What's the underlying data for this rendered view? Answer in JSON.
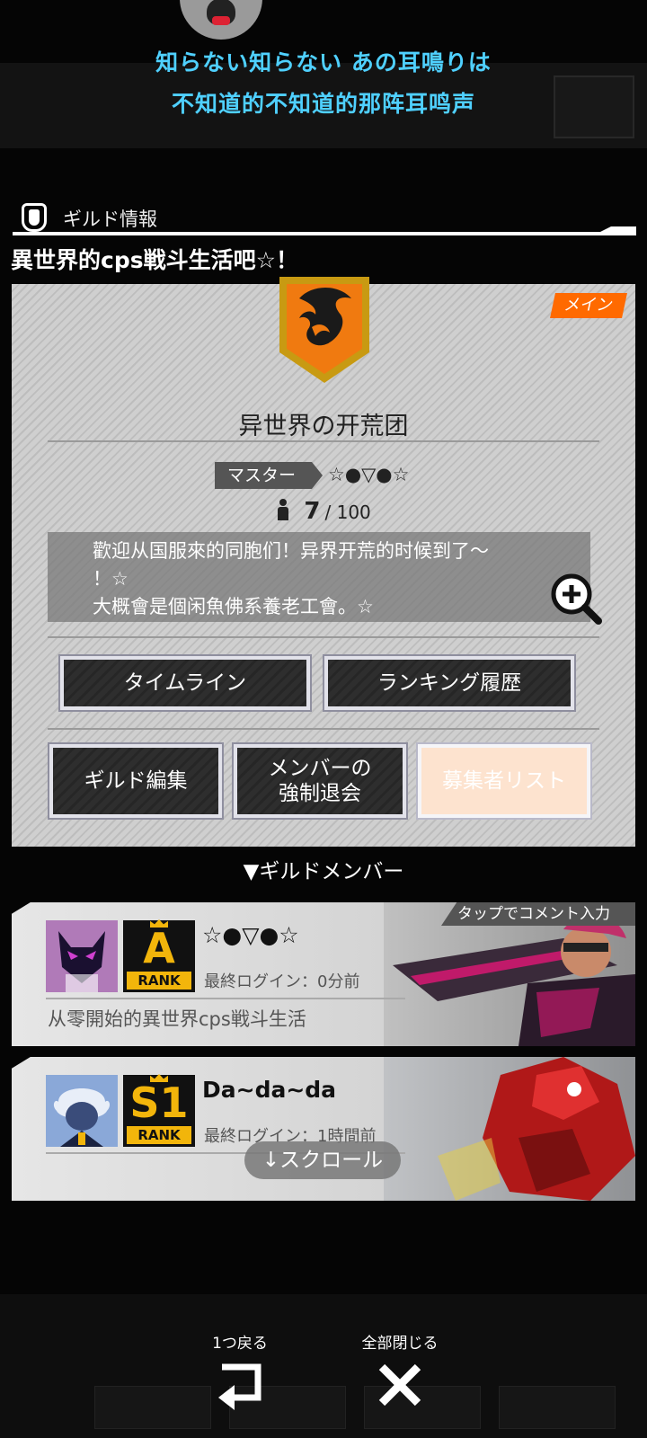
{
  "lyrics": {
    "line1": "知らない知らない あの耳鳴りは",
    "line2": "不知道的不知道的那阵耳鸣声"
  },
  "header": {
    "label": "ギルド情報"
  },
  "guild": {
    "display_name": "異世界的cps戦斗生活吧☆！",
    "badge": "メイン",
    "title": "异世界の开荒团",
    "master_label": "マスター",
    "master_name": "☆●▽●☆",
    "members_count": "7",
    "members_max": "/ 100",
    "description_line1": "歡迎从国服來的同胞们！异界开荒的时候到了～",
    "description_line2": "！☆",
    "description_line3": "大概會是個闲魚佛系養老工會。☆"
  },
  "buttons": {
    "timeline": "タイムライン",
    "ranking_history": "ランキング履歴",
    "guild_edit": "ギルド編集",
    "kick_member_1": "メンバーの",
    "kick_member_2": "強制退会",
    "applicant_list": "募集者リスト"
  },
  "members_header": "▼ギルドメンバー",
  "members": [
    {
      "name": "☆●▽●☆",
      "rank": "A",
      "rank_label": "RANK",
      "last_login": "最終ログイン：0分前",
      "comment": "从零開始的異世界cps戦斗生活",
      "tap_hint": "タップでコメント入力"
    },
    {
      "name": "Da~da~da",
      "rank": "S1",
      "rank_label": "RANK",
      "last_login": "最終ログイン：1時間前",
      "comment": ""
    }
  ],
  "scroll_hint": "↓スクロール",
  "nav": {
    "back_label": "1つ戻る",
    "close_all_label": "全部閉じる"
  },
  "colors": {
    "accent_orange": "#ff6a00",
    "lyric_blue": "#4fd0ff",
    "rank_gold": "#f2b50b"
  }
}
